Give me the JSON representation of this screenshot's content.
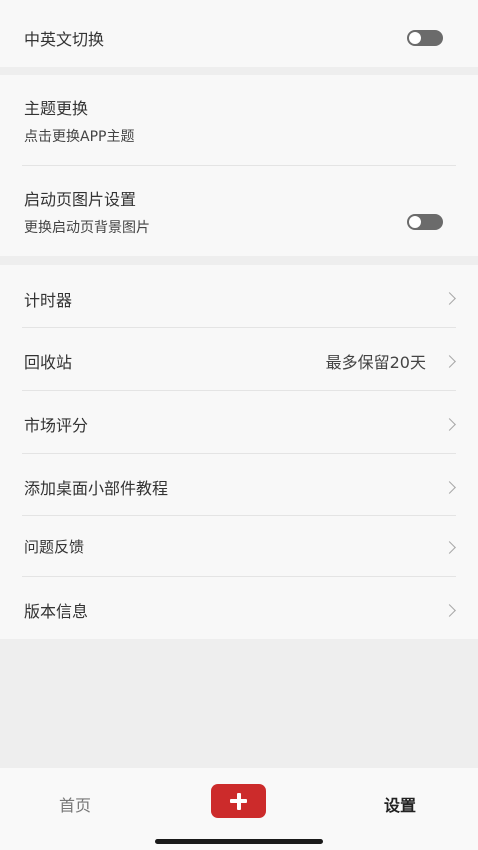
{
  "settings": {
    "language_toggle": {
      "label": "中英文切换",
      "on": false
    },
    "theme": {
      "title": "主题更换",
      "subtitle": "点击更换APP主题"
    },
    "splash": {
      "title": "启动页图片设置",
      "subtitle": "更换启动页背景图片",
      "on": false
    },
    "timer": {
      "label": "计时器"
    },
    "recycle_bin": {
      "label": "回收站",
      "value": "最多保留20天"
    },
    "market_rating": {
      "label": "市场评分"
    },
    "widget_tutorial": {
      "label": "添加桌面小部件教程"
    },
    "feedback": {
      "label": "问题反馈"
    },
    "version_info": {
      "label": "版本信息"
    }
  },
  "tabbar": {
    "home_label": "首页",
    "add_icon": "plus-icon",
    "settings_label": "设置",
    "active_tab": "设置",
    "accent_color": "#cc2b2b"
  },
  "icons": {
    "chevron": "chevron-right-icon",
    "toggle": "toggle-switch"
  }
}
